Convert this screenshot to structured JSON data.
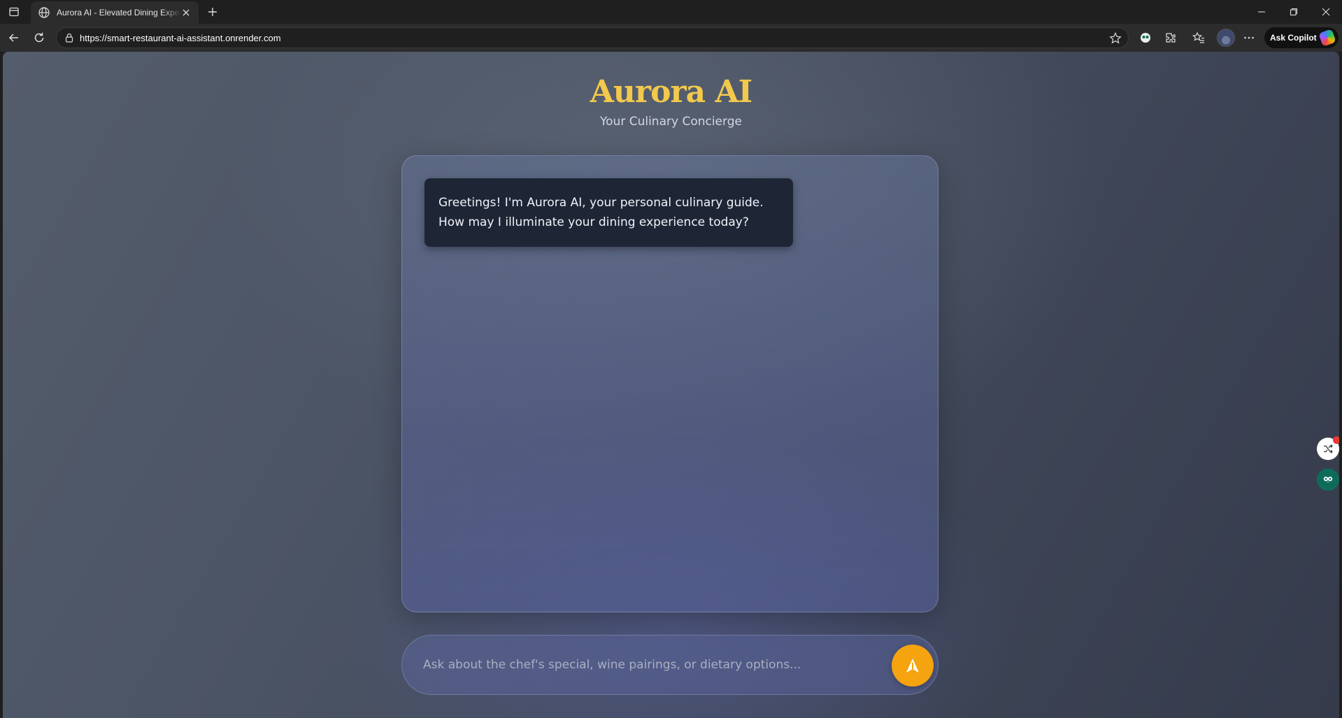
{
  "browser": {
    "tab": {
      "title": "Aurora AI - Elevated Dining Exper"
    },
    "address_bar": {
      "url": "https://smart-restaurant-ai-assistant.onrender.com"
    },
    "copilot": {
      "label": "Ask Copilot"
    },
    "icons": [
      "tab-actions-icon",
      "globe-icon",
      "close-icon",
      "plus-icon",
      "minimize-icon",
      "restore-icon",
      "close-window-icon",
      "back-icon",
      "refresh-icon",
      "lock-icon",
      "star-icon",
      "extension-icon",
      "favorites-icon",
      "more-icon"
    ]
  },
  "app": {
    "title": "Aurora AI",
    "subtitle": "Your Culinary Concierge",
    "messages": [
      {
        "role": "assistant",
        "text": "Greetings! I'm Aurora AI, your personal culinary guide. How may I illuminate your dining experience today?"
      }
    ],
    "input": {
      "value": "",
      "placeholder": "Ask about the chef's special, wine pairings, or dietary options..."
    },
    "send_icon": "send-arrow-icon"
  },
  "colors": {
    "title_gold": "#f2c94c",
    "send_button": "#f5a30f",
    "bubble_bg": "#1e2535"
  }
}
